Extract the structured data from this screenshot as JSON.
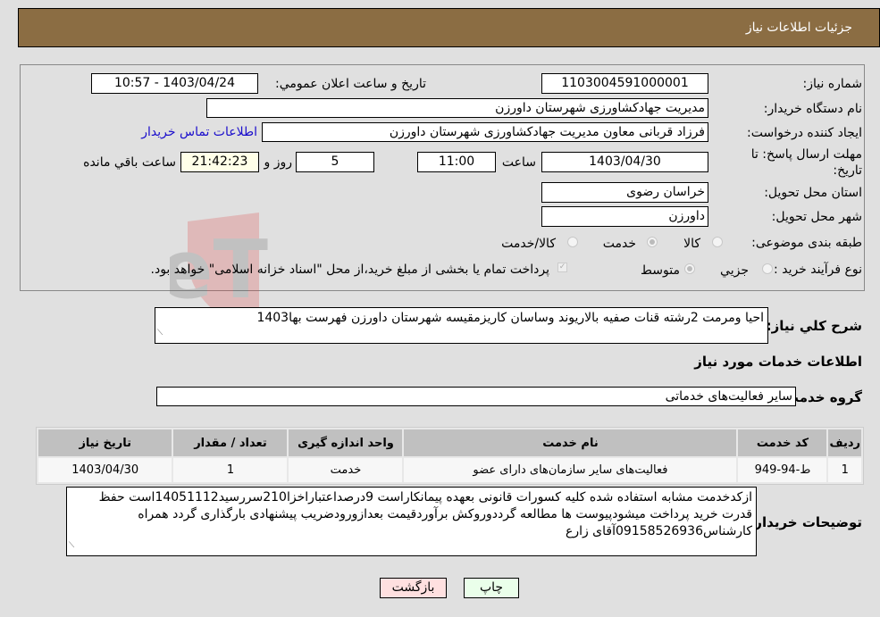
{
  "header": {
    "title": "جزئیات اطلاعات نیاز"
  },
  "form": {
    "need_number_label": "شماره نیاز:",
    "need_number": "1103004591000001",
    "announce_label": "تاریخ و ساعت اعلان عمومي:",
    "announce_value": "1403/04/24 - 10:57",
    "buyer_org_label": "نام دستگاه خریدار:",
    "buyer_org": "مدیریت جهادکشاورزی شهرستان داورزن",
    "requester_label": "ایجاد کننده درخواست:",
    "requester": "فرزاد قربانی معاون مدیریت جهادکشاورزی شهرستان داورزن",
    "contact_link": "اطلاعات تماس خریدار",
    "deadline_label_line1": "مهلت ارسال پاسخ: تا",
    "deadline_label_line2": "تاریخ:",
    "deadline_date": "1403/04/30",
    "time_label": "ساعت",
    "deadline_time": "11:00",
    "days_value": "5",
    "days_label": "روز و",
    "remaining_time": "21:42:23",
    "remaining_label": "ساعت باقي مانده",
    "province_label": "استان محل تحویل:",
    "province": "خراسان رضوی",
    "city_label": "شهر محل تحویل:",
    "city": "داورزن",
    "category_label": "طبقه بندی موضوعی:",
    "category_options": [
      "کالا",
      "خدمت",
      "کالا/خدمت"
    ],
    "category_selected": "خدمت",
    "process_label": "نوع فرآیند خرید :",
    "process_options": [
      "جزيي",
      "متوسط"
    ],
    "process_selected": "متوسط",
    "treasury_note": "پرداخت تمام یا بخشی از مبلغ خرید،از محل \"اسناد خزانه اسلامی\" خواهد بود.",
    "treasury_checked": true
  },
  "description": {
    "label": "شرح کلي نیاز:",
    "value": "احیا ومرمت 2رشته قنات صفیه بالاریوند وساسان کاریزمقیسه شهرستان داورزن فهرست بها1403"
  },
  "services": {
    "section_title": "اطلاعات خدمات مورد نیاز",
    "group_label": "گروه خدمت:",
    "group_value": "سایر فعالیت‌های خدماتی",
    "columns": [
      "ردیف",
      "کد خدمت",
      "نام خدمت",
      "واحد اندازه گیری",
      "تعداد / مقدار",
      "تاریخ نیاز"
    ],
    "rows": [
      [
        "1",
        "ط-94-949",
        "فعالیت‌های سایر سازمان‌های دارای عضو",
        "خدمت",
        "1",
        "1403/04/30"
      ]
    ]
  },
  "buyer_notes": {
    "label": "توضیحات خریدار:",
    "lines": [
      "ازکدخدمت مشابه استفاده شده کلیه کسورات قانونی بعهده پیمانکاراست 9درصداعتباراخزا210سررسید14051112است حفظ",
      "قدرت خرید پرداخت میشودپیوست ها مطالعه گرددوروکش برآوردقیمت بعدازورودضریب پیشنهادی بارگذاری گردد همراه",
      "کارشناس09158526936آقای زارع"
    ]
  },
  "buttons": {
    "print": "چاپ",
    "back": "بازگشت"
  },
  "watermark": {
    "text": "AriaTender.neT"
  },
  "colors": {
    "header": "#8b6d43",
    "link": "#1a0dcc",
    "print_bg": "#eaffea",
    "back_bg": "#ffe0e0",
    "remaining_bg": "#ffffe8"
  }
}
